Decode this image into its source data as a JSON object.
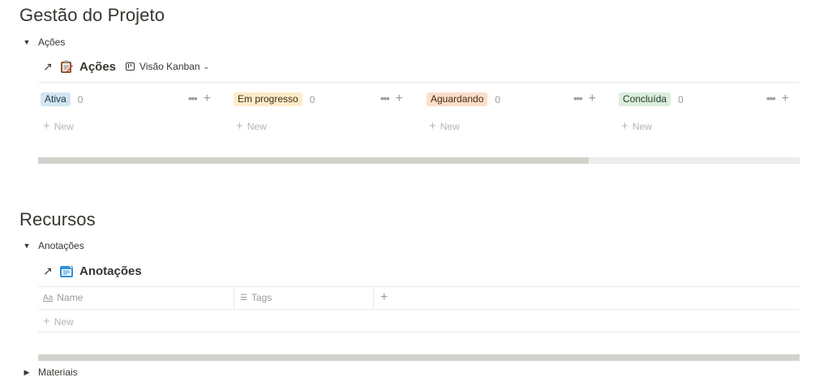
{
  "project": {
    "heading": "Gestão do Projeto",
    "toggle_label": "Ações",
    "db_title": "Ações",
    "view_label": "Visão Kanban",
    "columns": [
      {
        "label": "Ativa",
        "count": "0",
        "bg": "#d3e5ef",
        "fg": "#183347",
        "new_label": "New"
      },
      {
        "label": "Em progresso",
        "count": "0",
        "bg": "#fdecc8",
        "fg": "#402c1b",
        "new_label": "New"
      },
      {
        "label": "Aguardando",
        "count": "0",
        "bg": "#fadec9",
        "fg": "#49290e",
        "new_label": "New"
      },
      {
        "label": "Concluída",
        "count": "0",
        "bg": "#dbeddb",
        "fg": "#1c3829",
        "new_label": "New"
      }
    ],
    "dots": "•••",
    "plus": "+"
  },
  "resources": {
    "heading": "Recursos",
    "toggle_label": "Anotações",
    "db_title": "Anotações",
    "table_headers": [
      {
        "icon": "text-property-icon",
        "glyph": "Aa",
        "label": "Name"
      },
      {
        "icon": "list-property-icon",
        "glyph": "☰",
        "label": "Tags"
      }
    ],
    "add_column": "+",
    "new_row_label": "New"
  },
  "materials": {
    "toggle_label": "Materiais"
  },
  "colors": {
    "text": "#37352f",
    "muted": "#9b9a97",
    "divider": "#e9e9e7",
    "scroll_thumb": "#d3d1cb",
    "scroll_track": "#ededeb"
  }
}
